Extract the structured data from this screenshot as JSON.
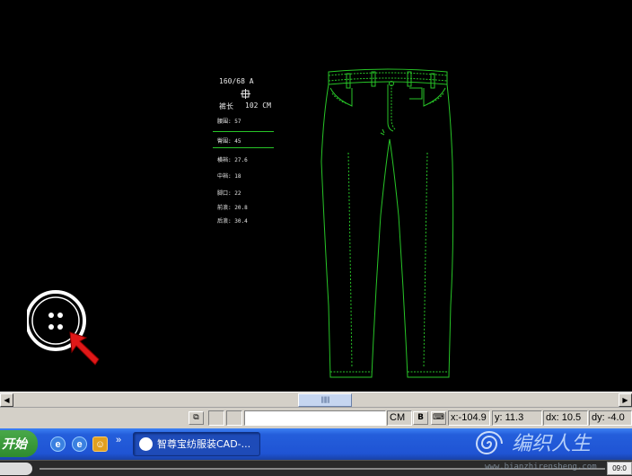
{
  "spec": {
    "size": "160/68 A",
    "length_label": "裤长",
    "length_value": "102 CM",
    "measurements": [
      {
        "label": "腰围:",
        "value": "57"
      },
      {
        "label": "臀围:",
        "value": "45"
      },
      {
        "label": "横裆:",
        "value": "27.6"
      },
      {
        "label": "中裆:",
        "value": "18"
      },
      {
        "label": "脚口:",
        "value": "22"
      },
      {
        "label": "前浪:",
        "value": "20.8"
      },
      {
        "label": "后浪:",
        "value": "30.4"
      }
    ]
  },
  "status": {
    "unit": "CM",
    "bold": "B",
    "x": "x:-104.9",
    "y": "y: 11.3",
    "dx": "dx: 10.5",
    "dy": "dy: -4.0"
  },
  "taskbar": {
    "start": "开始",
    "chevron": "»",
    "task_title": "智尊宝纺服装CAD-...",
    "watermark": "编织人生",
    "bottom_url": "www.bianzhirensheng.com",
    "clock": "09:0"
  },
  "scrollbar": {
    "left_arrow": "◀",
    "right_arrow": "▶",
    "grip": "|||||||"
  },
  "colors": {
    "outline": "#27c427",
    "canvas": "#000000",
    "taskbar": "#245edb"
  }
}
